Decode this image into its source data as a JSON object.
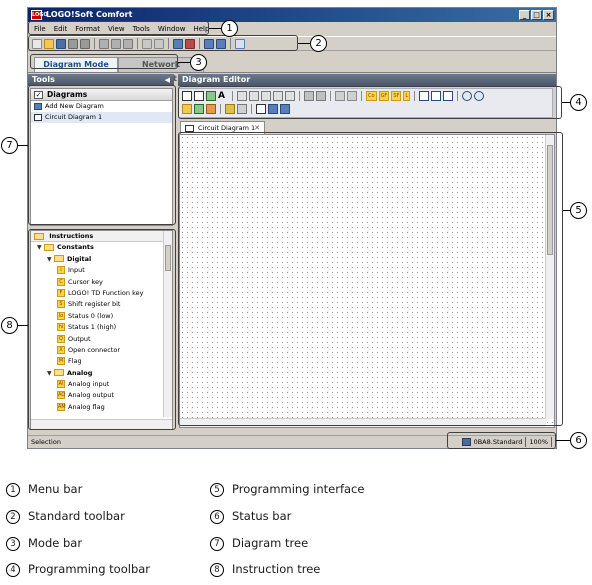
{
  "window": {
    "title": "LOGO!Soft Comfort",
    "logo_text": "LOGO",
    "controls": [
      "_",
      "□",
      "×"
    ]
  },
  "menubar": [
    "File",
    "Edit",
    "Format",
    "View",
    "Tools",
    "Window",
    "Help"
  ],
  "modes": {
    "active": "Diagram Mode",
    "inactive": "Network Project"
  },
  "tools": {
    "header": "Tools",
    "diagram_tree": {
      "header": "Diagrams",
      "items": [
        "Add New Diagram",
        "Circuit Diagram 1"
      ]
    },
    "instructions": {
      "header": "Instructions",
      "rows": [
        {
          "label": "Constants",
          "level": 1,
          "kind": "folder",
          "toggle": "▼"
        },
        {
          "label": "Digital",
          "level": 2,
          "kind": "folder",
          "toggle": "▼"
        },
        {
          "label": "Input",
          "level": 3,
          "badge": "I"
        },
        {
          "label": "Cursor key",
          "level": 3,
          "badge": "C"
        },
        {
          "label": "LOGO! TD Function key",
          "level": 3,
          "badge": "F"
        },
        {
          "label": "Shift register bit",
          "level": 3,
          "badge": "S"
        },
        {
          "label": "Status 0 (low)",
          "level": 3,
          "badge": "lo"
        },
        {
          "label": "Status 1 (high)",
          "level": 3,
          "badge": "hi"
        },
        {
          "label": "Output",
          "level": 3,
          "badge": "Q"
        },
        {
          "label": "Open connector",
          "level": 3,
          "badge": "X"
        },
        {
          "label": "Flag",
          "level": 3,
          "badge": "M"
        },
        {
          "label": "Analog",
          "level": 2,
          "kind": "folder",
          "toggle": "▼"
        },
        {
          "label": "Analog input",
          "level": 3,
          "badge": "AI"
        },
        {
          "label": "Analog output",
          "level": 3,
          "badge": "AQ"
        },
        {
          "label": "Analog flag",
          "level": 3,
          "badge": "AM"
        }
      ]
    }
  },
  "editor": {
    "header": "Diagram Editor",
    "tab_label": "Circuit Diagram 1",
    "tab_close": "✕",
    "toolbar_labels": [
      "Co",
      "GF",
      "SF",
      "L"
    ]
  },
  "statusbar": {
    "left": "Selection",
    "right": "0BA8.Standard",
    "zoom": "100%"
  },
  "callouts": [
    "1",
    "2",
    "3",
    "4",
    "5",
    "6",
    "7",
    "8"
  ],
  "legend": [
    {
      "num": "1",
      "text": "Menu bar"
    },
    {
      "num": "2",
      "text": "Standard toolbar"
    },
    {
      "num": "3",
      "text": "Mode bar"
    },
    {
      "num": "4",
      "text": "Programming toolbar"
    },
    {
      "num": "5",
      "text": "Programming interface"
    },
    {
      "num": "6",
      "text": "Status bar"
    },
    {
      "num": "7",
      "text": "Diagram tree"
    },
    {
      "num": "8",
      "text": "Instruction tree"
    }
  ]
}
